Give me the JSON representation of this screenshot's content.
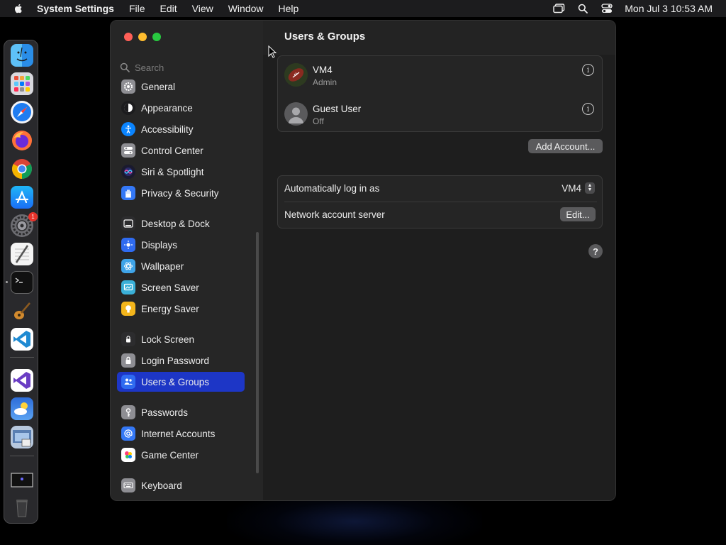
{
  "menubar": {
    "app_name": "System Settings",
    "menus": [
      "File",
      "Edit",
      "View",
      "Window",
      "Help"
    ],
    "clock": "Mon Jul 3  10:53 AM"
  },
  "dock": {
    "apps": [
      "finder",
      "launchpad",
      "safari",
      "firefox",
      "chrome",
      "app-store",
      "system-settings",
      "textedit",
      "terminal",
      "garageband",
      "vscode",
      "visual-studio",
      "weather",
      "preview",
      "screenshot",
      "trash"
    ],
    "settings_badge": "1"
  },
  "sidebar": {
    "search_placeholder": "Search",
    "items": [
      {
        "label": "General",
        "icon": "gear-icon",
        "color": "#8e8e93"
      },
      {
        "label": "Appearance",
        "icon": "appearance-icon",
        "color": "#1c1c1e"
      },
      {
        "label": "Accessibility",
        "icon": "accessibility-icon",
        "color": "#0a84ff"
      },
      {
        "label": "Control Center",
        "icon": "control-center-icon",
        "color": "#8e8e93"
      },
      {
        "label": "Siri & Spotlight",
        "icon": "siri-icon",
        "color": "#2a2a5a"
      },
      {
        "label": "Privacy & Security",
        "icon": "hand-icon",
        "color": "#3478f6"
      },
      {
        "label": "Desktop & Dock",
        "icon": "dock-icon",
        "color": "#2c2c2e"
      },
      {
        "label": "Displays",
        "icon": "sun-icon",
        "color": "#2f6bf0"
      },
      {
        "label": "Wallpaper",
        "icon": "wallpaper-icon",
        "color": "#3fa4e8"
      },
      {
        "label": "Screen Saver",
        "icon": "screen-saver-icon",
        "color": "#3ab0d8"
      },
      {
        "label": "Energy Saver",
        "icon": "bulb-icon",
        "color": "#f3b51b"
      },
      {
        "label": "Lock Screen",
        "icon": "lock-icon",
        "color": "#2c2c2e"
      },
      {
        "label": "Login Password",
        "icon": "padlock-icon",
        "color": "#8e8e93"
      },
      {
        "label": "Users & Groups",
        "icon": "users-icon",
        "color": "#2f6bf0"
      },
      {
        "label": "Passwords",
        "icon": "key-icon",
        "color": "#8e8e93"
      },
      {
        "label": "Internet Accounts",
        "icon": "at-icon",
        "color": "#3478f6"
      },
      {
        "label": "Game Center",
        "icon": "game-center-icon",
        "color": "#ffffff"
      },
      {
        "label": "Keyboard",
        "icon": "keyboard-icon",
        "color": "#8e8e93"
      }
    ],
    "active": "Users & Groups"
  },
  "content": {
    "title": "Users & Groups",
    "users": [
      {
        "name": "VM4",
        "role": "Admin"
      },
      {
        "name": "Guest User",
        "role": "Off"
      }
    ],
    "add_account_label": "Add Account...",
    "auto_login_label": "Automatically log in as",
    "auto_login_value": "VM4",
    "network_server_label": "Network account server",
    "edit_label": "Edit...",
    "help_label": "?"
  },
  "colors": {
    "accent": "#1d36c6",
    "close": "#ff5f57",
    "minimize": "#febc2e",
    "zoom": "#28c840"
  }
}
